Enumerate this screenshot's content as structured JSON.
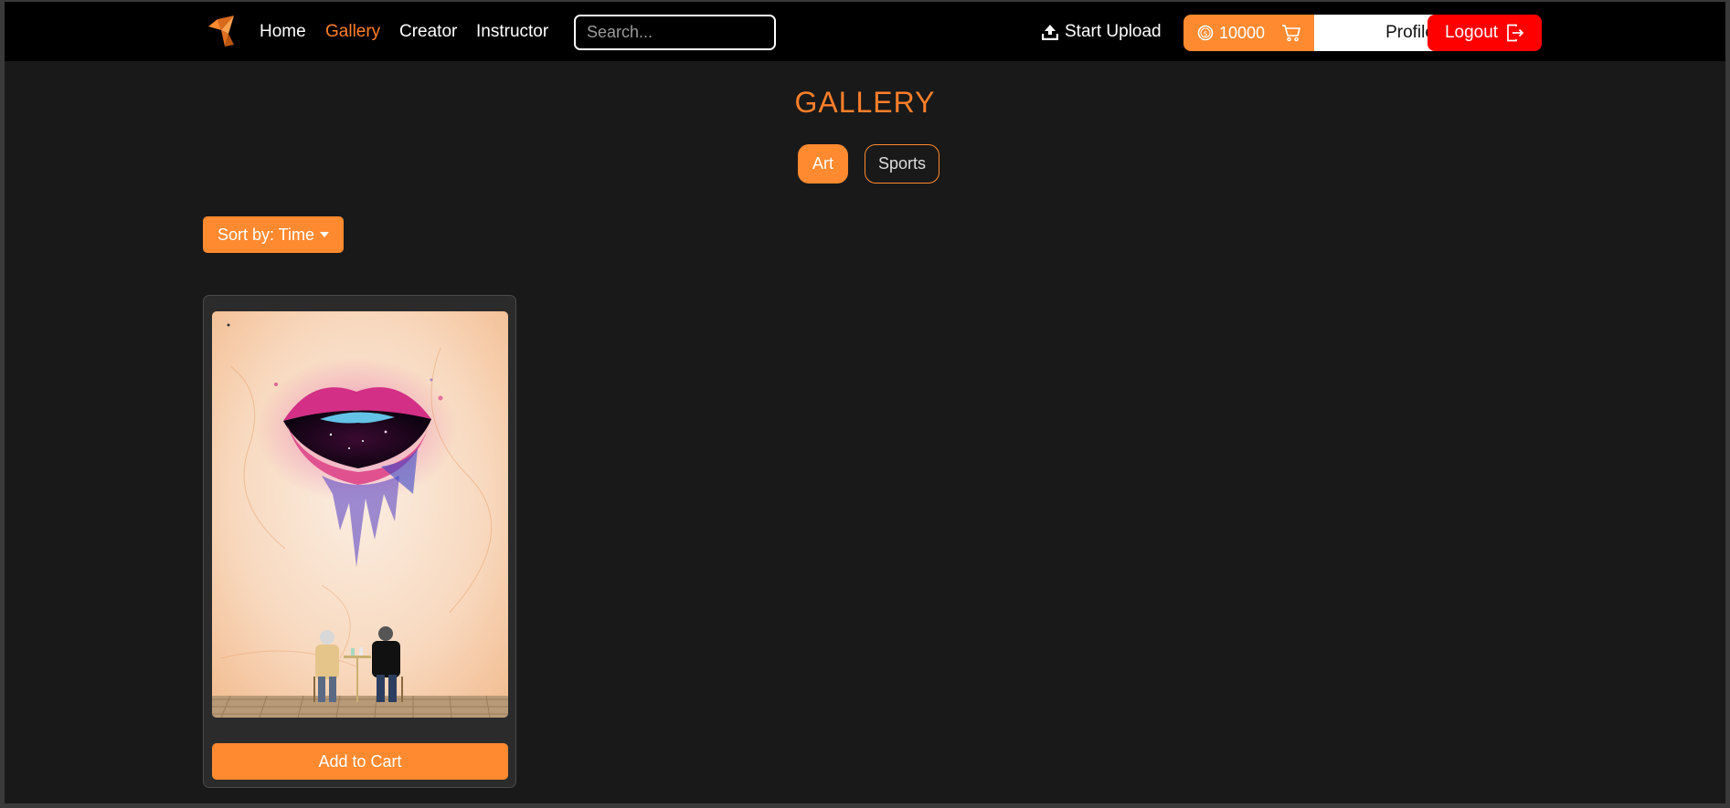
{
  "nav": {
    "links": [
      {
        "label": "Home"
      },
      {
        "label": "Gallery",
        "active": true
      },
      {
        "label": "Creator"
      },
      {
        "label": "Instructor"
      }
    ],
    "search_placeholder": "Search...",
    "upload_label": "Start Upload",
    "balance": "10000",
    "profile_label": "Profile",
    "logout_label": "Logout"
  },
  "page": {
    "title": "GALLERY",
    "categories": [
      {
        "label": "Art",
        "selected": true
      },
      {
        "label": "Sports",
        "selected": false
      }
    ],
    "sort_label": "Sort by: Time"
  },
  "gallery": {
    "items": [
      {
        "image": "watercolor-lips-artwork",
        "button_label": "Add to Cart"
      }
    ]
  },
  "colors": {
    "accent": "#ff8a30",
    "accent_text": "#ff7f2a",
    "navbar_bg": "#000000",
    "page_bg": "#191919",
    "logout_bg": "#ff0000"
  }
}
